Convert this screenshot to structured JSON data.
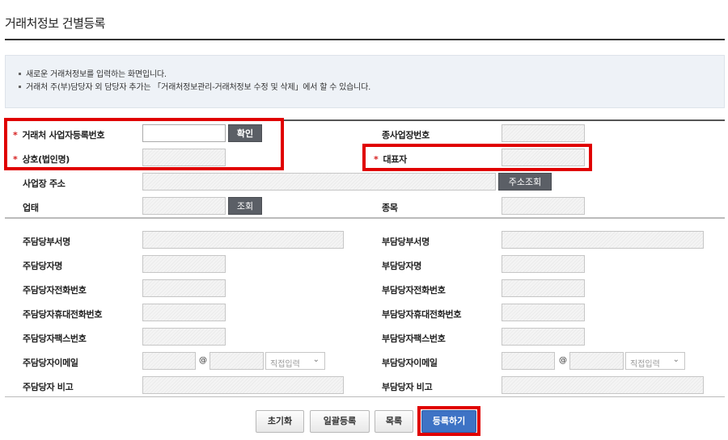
{
  "page": {
    "title": "거래처정보 건별등록"
  },
  "notice": {
    "lines": [
      "새로운 거래처정보를 입력하는 화면입니다.",
      "거래처 주(부)담당자 외 담당자 추가는 「거래처정보관리-거래처정보 수정 및 삭제」에서 할 수 있습니다."
    ]
  },
  "form": {
    "biz_reg_no_label": "거래처 사업자등록번호",
    "confirm_button": "확인",
    "sub_biz_no_label": "종사업장번호",
    "company_name_label": "상호(법인명)",
    "representative_label": "대표자",
    "address_label": "사업장 주소",
    "address_search_button": "주소조회",
    "business_type_label": "업태",
    "business_type_search_button": "조회",
    "business_item_label": "종목",
    "main_dept_label": "주담당부서명",
    "sub_dept_label": "부담당부서명",
    "main_name_label": "주담당자명",
    "sub_name_label": "부담당자명",
    "main_phone_label": "주담당자전화번호",
    "sub_phone_label": "부담당자전화번호",
    "main_mobile_label": "주담당자휴대전화번호",
    "sub_mobile_label": "부담당자휴대전화번호",
    "main_fax_label": "주담당자팩스번호",
    "sub_fax_label": "부담당자팩스번호",
    "main_email_label": "주담당자이메일",
    "sub_email_label": "부담당자이메일",
    "at_symbol": "@",
    "email_domain_select": "직접입력",
    "main_note_label": "주담당자 비고",
    "sub_note_label": "부담당자 비고"
  },
  "buttons": {
    "reset": "초기화",
    "bulk_register": "일괄등록",
    "list": "목록",
    "register": "등록하기"
  },
  "colors": {
    "highlight": "#e00000",
    "primary_button": "#3e73c5",
    "required_mark": "#d62020"
  }
}
